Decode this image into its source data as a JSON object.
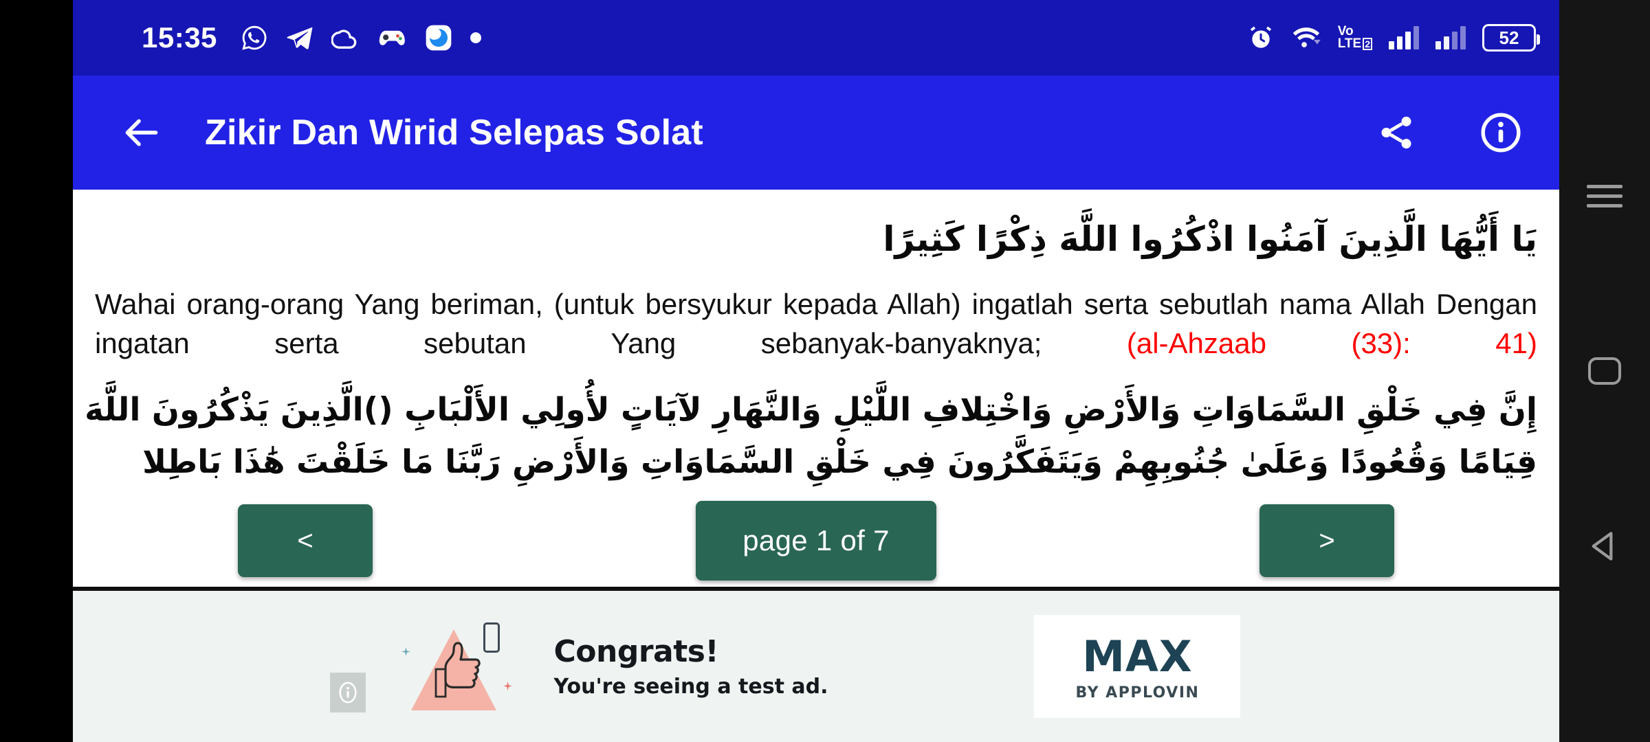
{
  "status_bar": {
    "clock": "15:35",
    "left_icons": [
      "whatsapp-icon",
      "telegram-icon",
      "cloud-icon",
      "game-controller-icon",
      "browser-icon",
      "dot-icon"
    ],
    "right_icons": [
      "alarm-icon",
      "wifi-icon",
      "volte-icon",
      "signal-sim1-icon",
      "signal-sim2-icon"
    ],
    "volte_line1": "Vo",
    "volte_line2": "LTE",
    "volte_sim": "2",
    "battery_percent": "52",
    "bg_color": "#1616b4"
  },
  "app_bar": {
    "back_icon": "arrow-back-icon",
    "title": "Zikir Dan Wirid Selepas Solat",
    "share_icon": "share-icon",
    "info_icon": "info-icon",
    "bg_color": "#2222e6"
  },
  "content": {
    "arabic_verse_1": "يَا أَيُّهَا الَّذِينَ آمَنُوا اذْكُرُوا اللَّهَ ذِكْرًا كَثِيرًا",
    "translation_text": "Wahai orang-orang Yang beriman, (untuk bersyukur kepada Allah) ingatlah serta sebutlah nama Allah Dengan ingatan serta sebutan Yang sebanyak-banyaknya; ",
    "citation": "(al-Ahzaab (33): 41)",
    "citation_color": "#ff0000",
    "arabic_verse_2": "إِنَّ فِي خَلْقِ السَّمَاوَاتِ وَالأَرْضِ وَاخْتِلافِ اللَّيْلِ وَالنَّهَارِ لآيَاتٍ لأُولِي الأَلْبَابِ ()الَّذِينَ يَذْكُرُونَ اللَّهَ",
    "arabic_verse_3": "قِيَامًا وَقُعُودًا وَعَلَىٰ جُنُوبِهِمْ وَيَتَفَكَّرُونَ فِي خَلْقِ السَّمَاوَاتِ وَالأَرْضِ رَبَّنَا مَا خَلَقْتَ هَٰذَا بَاطِلا"
  },
  "pager": {
    "prev_label": "<",
    "page_label": "page 1 of 7",
    "next_label": ">",
    "button_color": "#2a6654",
    "current_page": 1,
    "total_pages": 7
  },
  "ad": {
    "info_icon": "ad-info-icon",
    "headline": "Congrats!",
    "subtext": "You're seeing a test ad.",
    "logo_main": "MAX",
    "logo_sub": "BY APPLOVIN",
    "bg_color": "#eff4f2"
  },
  "nav_bar": {
    "recents_icon": "recents-icon",
    "home_icon": "home-icon",
    "back_icon": "nav-back-icon"
  }
}
